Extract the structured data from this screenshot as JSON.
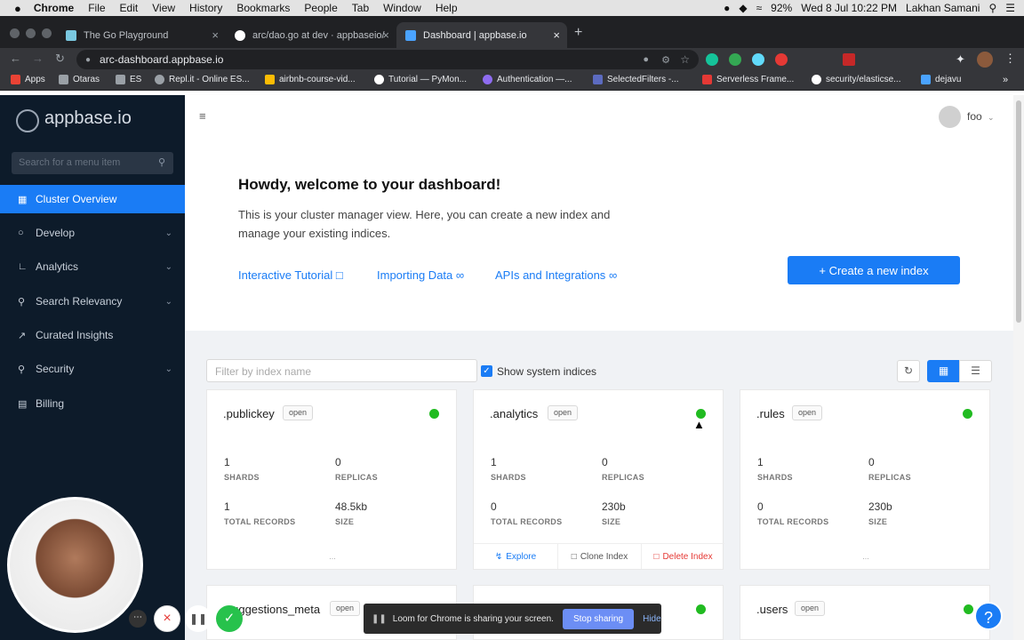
{
  "macbar": {
    "apple": "",
    "app": "Chrome",
    "menus": [
      "File",
      "Edit",
      "View",
      "History",
      "Bookmarks",
      "People",
      "Tab",
      "Window",
      "Help"
    ],
    "battery": "92%",
    "datetime": "Wed 8 Jul  10:22 PM",
    "user": "Lakhan Samani"
  },
  "tabs": [
    {
      "title": "The Go Playground",
      "fav_color": "#7ac8e0"
    },
    {
      "title": "arc/dao.go at dev · appbaseio/",
      "fav_color": "#ffffff"
    },
    {
      "title": "Dashboard | appbase.io",
      "fav_color": "#4aa3ff"
    }
  ],
  "omnibox": {
    "url": "arc-dashboard.appbase.io"
  },
  "bookmarks": [
    "Apps",
    "Otaras",
    "ES",
    "Repl.it - Online ES...",
    "airbnb-course-vid...",
    "Tutorial — PyMon...",
    "Authentication —...",
    "SelectedFilters -...",
    "Serverless Frame...",
    "security/elasticse...",
    "dejavu"
  ],
  "sidebar": {
    "logo": "appbase.io",
    "search_placeholder": "Search for a menu item",
    "items": [
      {
        "label": "Cluster Overview",
        "icon": "cluster-icon",
        "active": true,
        "expandable": false
      },
      {
        "label": "Develop",
        "icon": "code-icon",
        "active": false,
        "expandable": true
      },
      {
        "label": "Analytics",
        "icon": "chart-icon",
        "active": false,
        "expandable": true
      },
      {
        "label": "Search Relevancy",
        "icon": "search-icon",
        "active": false,
        "expandable": true
      },
      {
        "label": "Curated Insights",
        "icon": "trend-icon",
        "active": false,
        "expandable": false
      },
      {
        "label": "Security",
        "icon": "lock-icon",
        "active": false,
        "expandable": true
      },
      {
        "label": "Billing",
        "icon": "billing-icon",
        "active": false,
        "expandable": false
      }
    ]
  },
  "header": {
    "user": "foo"
  },
  "welcome": {
    "title": "Howdy, welcome to your dashboard!",
    "body": "This is your cluster manager view. Here, you can create a new index and manage your existing indices.",
    "links": [
      "Interactive Tutorial",
      "Importing Data",
      "APIs and Integrations"
    ],
    "create_button": "+  Create a new index"
  },
  "filters": {
    "search_placeholder": "Filter by index name",
    "show_system": "Show system indices",
    "show_system_checked": true
  },
  "indices": [
    {
      "name": ".publickey",
      "status": "open",
      "shards": "1",
      "replicas": "0",
      "records": "1",
      "size": "48.5kb"
    },
    {
      "name": ".analytics",
      "status": "open",
      "shards": "1",
      "replicas": "0",
      "records": "0",
      "size": "230b"
    },
    {
      "name": ".rules",
      "status": "open",
      "shards": "1",
      "replicas": "0",
      "records": "0",
      "size": "230b"
    },
    {
      "name": ".suggestions_meta",
      "status": "open"
    },
    {
      "name": "",
      "status": ""
    },
    {
      "name": ".users",
      "status": "open"
    }
  ],
  "card_labels": {
    "shards": "SHARDS",
    "replicas": "REPLICAS",
    "records": "TOTAL RECORDS",
    "size": "SIZE",
    "more": "..."
  },
  "card_actions": {
    "explore": "Explore",
    "clone": "Clone Index",
    "delete": "Delete Index"
  },
  "loom": {
    "message": "Loom for Chrome is sharing your screen.",
    "stop": "Stop sharing",
    "hide": "Hide"
  },
  "help_button": "?"
}
